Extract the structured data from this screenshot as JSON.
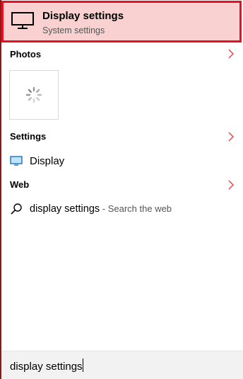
{
  "best_match": {
    "title": "Display settings",
    "subtitle": "System settings",
    "icon": "monitor-icon"
  },
  "sections": {
    "photos": {
      "label": "Photos"
    },
    "settings": {
      "label": "Settings"
    },
    "web": {
      "label": "Web"
    }
  },
  "settings_results": [
    {
      "label": "Display",
      "icon": "display-icon"
    }
  ],
  "web_result": {
    "query": "display settings",
    "separator": " - ",
    "hint": "Search the web"
  },
  "search": {
    "value": "display settings"
  },
  "colors": {
    "highlight_fill": "#f9d1d1",
    "highlight_border": "#e81123",
    "chevron": "#e84a4a",
    "left_edge": "#8b1a1a"
  }
}
